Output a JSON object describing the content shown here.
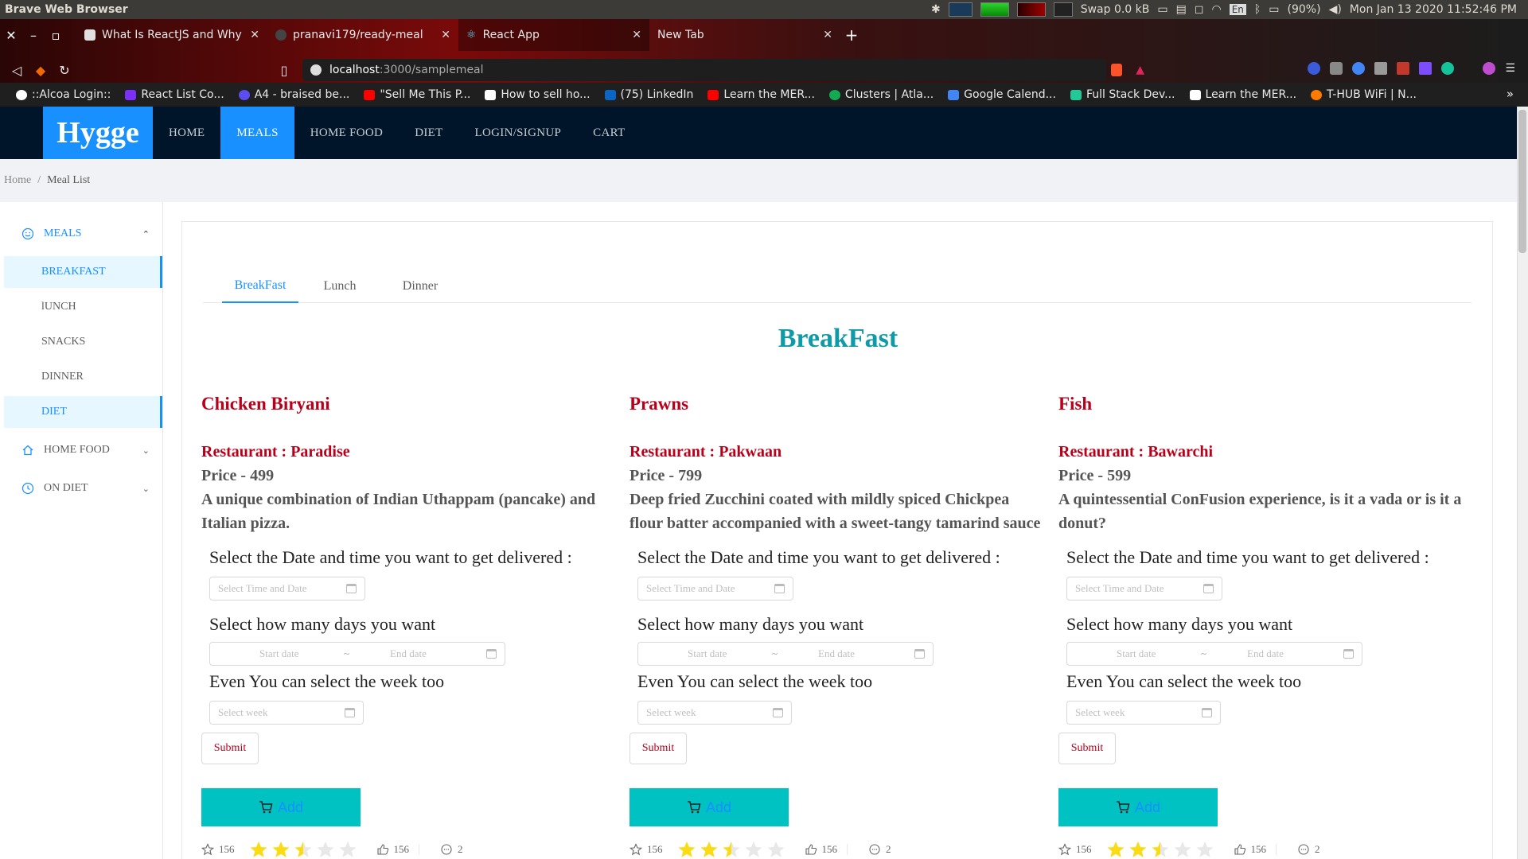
{
  "os": {
    "app_title": "Brave Web Browser",
    "swap": "Swap 0.0 kB",
    "lang": "En",
    "battery": "(90%)",
    "datetime": "Mon Jan 13 2020 11:52:46 PM"
  },
  "browser": {
    "tabs": [
      {
        "title": "What Is ReactJS and Why Sh",
        "color": "#e0e0e0"
      },
      {
        "title": "pranavi179/ready-meal",
        "color": "#444444"
      },
      {
        "title": "React App",
        "color": "#61dafb"
      },
      {
        "title": "New Tab",
        "color": ""
      }
    ],
    "url_host": "localhost",
    "url_path": ":3000/samplemeal",
    "bookmarks": [
      {
        "label": "::Alcoa Login::",
        "color": "#ffffff"
      },
      {
        "label": "React List Co...",
        "color": "#7b2ff7"
      },
      {
        "label": "A4 - braised be...",
        "color": "#5b4df0"
      },
      {
        "label": "\"Sell Me This P...",
        "color": "#ff0000"
      },
      {
        "label": "How to sell ho...",
        "color": "#ffffff"
      },
      {
        "label": "(75) LinkedIn",
        "color": "#0a66c2"
      },
      {
        "label": "Learn the MER...",
        "color": "#ff0000"
      },
      {
        "label": "Clusters | Atla...",
        "color": "#13aa52"
      },
      {
        "label": "Google Calend...",
        "color": "#4285f4"
      },
      {
        "label": "Full Stack Dev...",
        "color": "#20c997"
      },
      {
        "label": "Learn the MER...",
        "color": "#ffffff"
      },
      {
        "label": "T-HUB WiFi | N...",
        "color": "#ff7a00"
      }
    ],
    "bookmarks_more": "»"
  },
  "app": {
    "brand": "Hygge",
    "nav": [
      "HOME",
      "MEALS",
      "HOME FOOD",
      "DIET",
      "LOGIN/SIGNUP",
      "CART"
    ],
    "breadcrumb": {
      "home": "Home",
      "sep": "/",
      "current": "Meal List"
    },
    "sidebar": {
      "meals": "MEALS",
      "items": [
        "BREAKFAST",
        "lUNCH",
        "SNACKS",
        "DINNER",
        "DIET"
      ],
      "home_food": "HOME FOOD",
      "on_diet": "ON DIET"
    },
    "tabs": [
      "BreakFast",
      "Lunch",
      "Dinner"
    ],
    "section_title": "BreakFast",
    "meals": [
      {
        "name": "Chicken Biryani",
        "restaurant": "Restaurant : Paradise",
        "price": "Price - 499",
        "description": "A unique combination of Indian Uthappam (pancake) and Italian pizza."
      },
      {
        "name": "Prawns",
        "restaurant": "Restaurant : Pakwaan",
        "price": "Price - 799",
        "description": "Deep fried Zucchini coated with mildly spiced Chickpea flour batter accompanied with a sweet-tangy tamarind sauce"
      },
      {
        "name": "Fish",
        "restaurant": "Restaurant : Bawarchi",
        "price": "Price - 599",
        "description": "A quintessential ConFusion experience, is it a vada or is it a donut?"
      }
    ],
    "form": {
      "q_date": "Select the Date and time you want to get delivered :",
      "date_placeholder": "Select Time and Date",
      "q_days": "Select how many days you want",
      "start_placeholder": "Start date",
      "range_sep": "~",
      "end_placeholder": "End date",
      "q_week": "Even You can select the week too",
      "week_placeholder": "Select week",
      "submit": "Submit",
      "add": "Add"
    },
    "actions": {
      "star_count": "156",
      "rating": 2.5,
      "rating_max": 5,
      "like_count": "156",
      "message_count": "2"
    },
    "colors": {
      "brand_blue": "#1890ff",
      "nav_dark": "#001529",
      "meal_red": "#b8001a",
      "title_teal": "#0e9aa7",
      "add_button": "#00c2c2",
      "star_yellow": "#fadb14"
    }
  }
}
